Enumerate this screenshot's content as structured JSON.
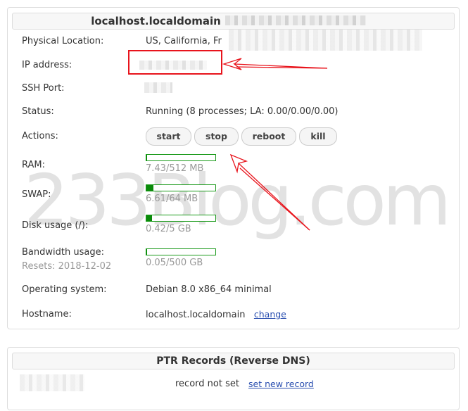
{
  "server": {
    "title": "localhost.localdomain",
    "rows": {
      "location": {
        "label": "Physical Location:",
        "value": "US, California, Fr"
      },
      "ip": {
        "label": "IP address:"
      },
      "ssh": {
        "label": "SSH Port:"
      },
      "status": {
        "label": "Status:",
        "value": "Running (8 processes; LA: 0.00/0.00/0.00)"
      },
      "actions": {
        "label": "Actions:",
        "buttons": [
          "start",
          "stop",
          "reboot",
          "kill"
        ]
      },
      "ram": {
        "label": "RAM:",
        "value": "7.43/512 MB",
        "percent": 1.5
      },
      "swap": {
        "label": "SWAP:",
        "value": "6.61/64 MB",
        "percent": 10.3
      },
      "disk": {
        "label": "Disk usage (/):",
        "value": "0.42/5 GB",
        "percent": 8.4
      },
      "bandwidth": {
        "label": "Bandwidth usage:",
        "sublabel": "Resets: 2018-12-02",
        "value": "0.05/500 GB",
        "percent": 0.01
      },
      "os": {
        "label": "Operating system:",
        "value": "Debian 8.0 x86_64 minimal"
      },
      "hostname": {
        "label": "Hostname:",
        "value": "localhost.localdomain",
        "link": "change"
      }
    }
  },
  "ptr": {
    "title": "PTR Records (Reverse DNS)",
    "status": "record not set",
    "link": "set new record"
  },
  "watermark": "233Blog.com",
  "colors": {
    "bar": "#0a8a0a",
    "annotation": "#e8141c",
    "link": "#2a4fb0"
  }
}
